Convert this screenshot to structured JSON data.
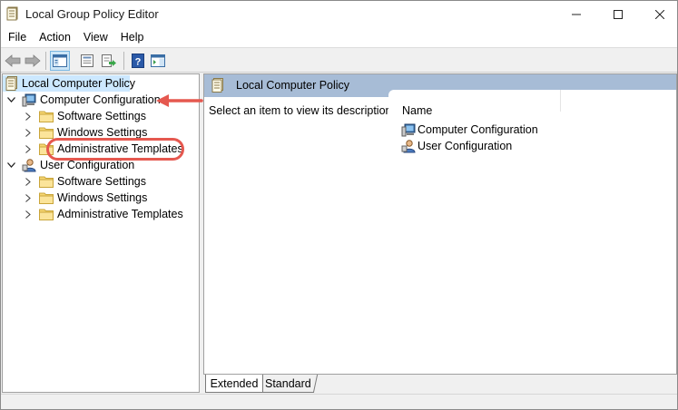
{
  "window": {
    "title": "Local Group Policy Editor"
  },
  "menu": {
    "items": [
      "File",
      "Action",
      "View",
      "Help"
    ]
  },
  "toolbar": {
    "buttons": [
      "back-arrow-icon",
      "forward-arrow-icon",
      "show-hide-tree-icon",
      "properties-icon",
      "export-list-icon",
      "help-icon",
      "show-action-pane-icon"
    ]
  },
  "tree": {
    "root": "Local Computer Policy",
    "computer_config": {
      "label": "Computer Configuration",
      "children": [
        "Software Settings",
        "Windows Settings",
        "Administrative Templates"
      ]
    },
    "user_config": {
      "label": "User Configuration",
      "children": [
        "Software Settings",
        "Windows Settings",
        "Administrative Templates"
      ]
    }
  },
  "content": {
    "header_title": "Local Computer Policy",
    "description": "Select an item to view its description.",
    "column_name": "Name",
    "items": [
      "Computer Configuration",
      "User Configuration"
    ]
  },
  "tabs": {
    "extended": "Extended",
    "standard": "Standard"
  },
  "colors": {
    "header_bg": "#a7bcd6",
    "annotation": "#e5584f",
    "selected_row": "#cce8ff"
  }
}
